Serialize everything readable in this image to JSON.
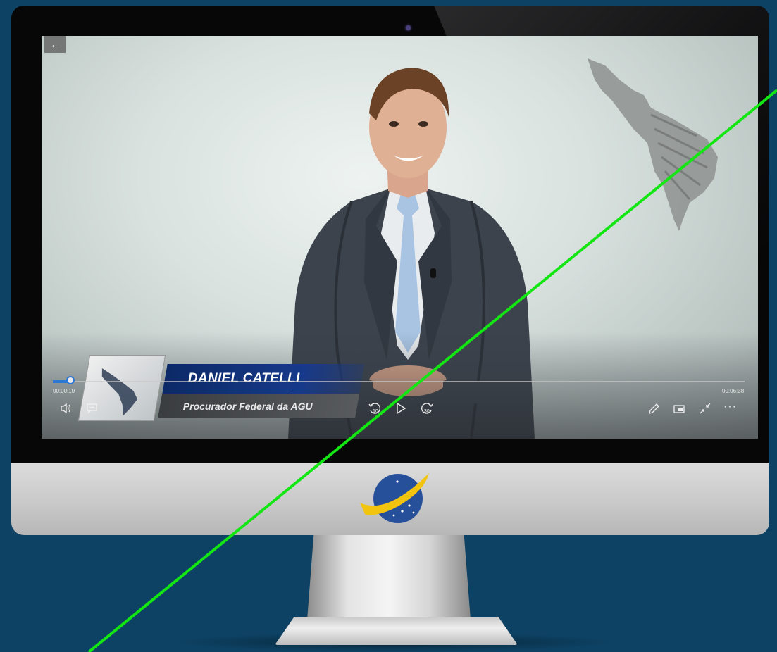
{
  "player": {
    "back_icon": "←",
    "current_time": "00:00:10",
    "total_time": "00:06:38",
    "progress_fraction": 0.025
  },
  "lower_third": {
    "name": "DANIEL CATELLI",
    "role": "Procurador Federal da AGU"
  },
  "controls": {
    "rewind_label": "10",
    "forward_label": "30"
  },
  "colors": {
    "background": "#0d4264",
    "accent": "#2b79d4",
    "name_bar": "#0c2a67",
    "overlay_line": "#14e614"
  },
  "icons": [
    "arrow-left-icon",
    "volume-icon",
    "subtitles-icon",
    "rewind-10-icon",
    "play-icon",
    "forward-30-icon",
    "pencil-icon",
    "miniplayer-icon",
    "exit-fullscreen-icon",
    "more-icon",
    "logo-icon"
  ]
}
